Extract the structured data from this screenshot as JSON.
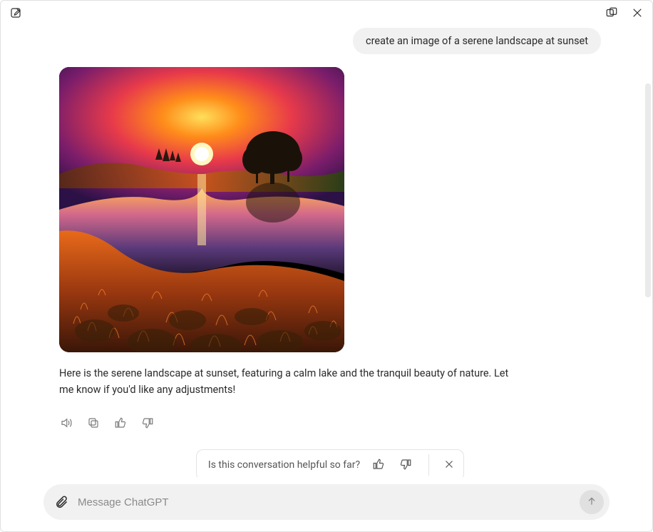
{
  "user_message": "create an image of a serene landscape at sunset",
  "assistant_message": "Here is the serene landscape at sunset, featuring a calm lake and the tranquil beauty of nature. Let me know if you'd like any adjustments!",
  "helpful_prompt": "Is this conversation helpful so far?",
  "composer": {
    "placeholder": "Message ChatGPT"
  },
  "icons": {
    "new_chat": "new-chat-icon",
    "expand": "expand-icon",
    "close": "close-icon",
    "speaker": "speaker-icon",
    "copy": "copy-icon",
    "thumbs_up": "thumbs-up-icon",
    "thumbs_down": "thumbs-down-icon",
    "dismiss": "dismiss-icon",
    "attach": "attach-icon",
    "send": "send-icon"
  }
}
